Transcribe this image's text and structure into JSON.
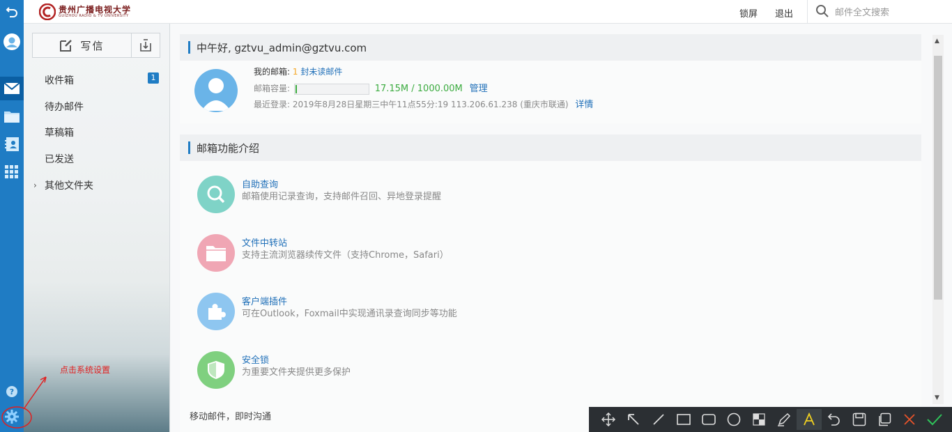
{
  "header": {
    "logo_cn": "贵州广播电视大学",
    "logo_en": "GUIZHOU RADIO & TV UNIVERSITY",
    "lock_label": "锁屏",
    "logout_label": "退出",
    "search_placeholder": "邮件全文搜索"
  },
  "rail": {
    "items": [
      "back-icon",
      "user-avatar-icon",
      "mail-icon",
      "folder-icon",
      "contacts-icon",
      "apps-grid-icon",
      "help-icon",
      "settings-gear-icon"
    ],
    "active": "mail-icon"
  },
  "compose": {
    "write_label": "写信"
  },
  "folders": {
    "items": [
      {
        "label": "收件箱",
        "badge": "1"
      },
      {
        "label": "待办邮件"
      },
      {
        "label": "草稿箱"
      },
      {
        "label": "已发送"
      },
      {
        "label": "其他文件夹"
      }
    ]
  },
  "welcome": {
    "greeting": "中午好, gztvu_admin@gztvu.com",
    "mailbox_label": "我的邮箱:",
    "unread_count": "1",
    "unread_text": "封未读邮件",
    "quota_label": "邮箱容量:",
    "quota_text": "17.15M / 1000.00M",
    "quota_fraction": 0.01715,
    "manage_label": "管理",
    "last_login_text": "最近登录: 2019年8月28日星期三中午11点55分:19   113.206.61.238 (重庆市联通)",
    "detail_label": "详情"
  },
  "features": {
    "title": "邮箱功能介绍",
    "items": [
      {
        "icon": "search-icon",
        "title": "自助查询",
        "desc": "邮箱使用记录查询，支持邮件召回、异地登录提醒",
        "color": "#7fd3c7"
      },
      {
        "icon": "folder-icon",
        "title": "文件中转站",
        "desc": "支持主流浏览器续传文件（支持Chrome，Safari）",
        "color": "#f0a6b4"
      },
      {
        "icon": "puzzle-icon",
        "title": "客户端插件",
        "desc": "可在Outlook，Foxmail中实现通讯录查询同步等功能",
        "color": "#8ec6f0"
      },
      {
        "icon": "shield-icon",
        "title": "安全锁",
        "desc": "为重要文件夹提供更多保护",
        "color": "#7fd07f"
      }
    ],
    "cut_text": "移动邮件，即时沟通"
  },
  "annotation": {
    "text": "点击系统设置",
    "color": "#e02020"
  },
  "toolbar": {
    "tools": [
      "move-icon",
      "arrow-icon",
      "line-icon",
      "rectangle-icon",
      "rounded-rectangle-icon",
      "ellipse-icon",
      "mosaic-icon",
      "pen-icon",
      "text-icon",
      "undo-icon",
      "save-icon",
      "copy-icon",
      "cancel-icon",
      "confirm-icon"
    ],
    "selected": "text-icon"
  },
  "colors": {
    "accent": "#1f7cc4",
    "link": "#1f6fb8",
    "quota_green": "#3bab3f",
    "unread_orange": "#f5a623"
  }
}
